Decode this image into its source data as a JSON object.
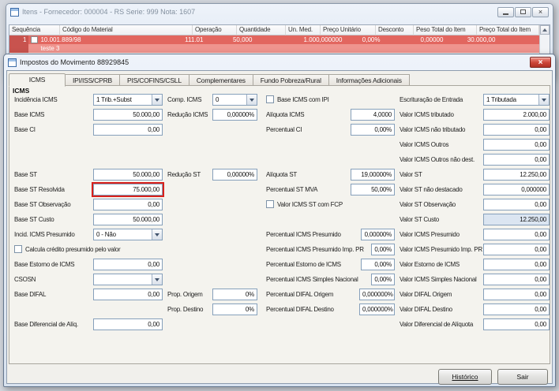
{
  "colors": {
    "highlight_border": "#d8201b",
    "row_red": "#e2665f",
    "row_red_dark": "#c8534e",
    "row_red_light": "#ef948e",
    "tinted_field": "#dbe5f1"
  },
  "items_window": {
    "title": "Itens - Fornecedor: 000004 - RS Serie: 999  Nota: 1607",
    "table": {
      "columns": [
        "Sequência",
        "Código do Material",
        "Operação",
        "Quantidade",
        "Un. Med.",
        "Preço Unitário",
        "Desconto",
        "Peso Total do Item",
        "Preço Total do Item"
      ],
      "row": {
        "seq": "1",
        "codigo": "10.001.889/98",
        "codigo_line2": "teste 3",
        "operacao": "111.01",
        "quantidade": "50,000",
        "un_med": "",
        "preco_unitario": "1.000,000000",
        "desconto": "0,00%",
        "peso_total": "0,00000",
        "preco_total": "30.000,00"
      }
    }
  },
  "tax_dialog": {
    "title": "Impostos do Movimento 88929845",
    "tabs": [
      "ICMS",
      "IPI/ISS/CPRB",
      "PIS/COFINS/CSLL",
      "Complementares",
      "Fundo Pobreza/Rural",
      "Informações Adicionais"
    ],
    "active_tab_index": 0,
    "group_label": "ICMS",
    "footer_buttons": [
      {
        "label": "Histórico"
      },
      {
        "label": "Sair"
      }
    ]
  },
  "fields": [
    {
      "c": "a",
      "r": 1,
      "label": "Incidência ICMS",
      "value": "1 Trib.+Subst",
      "type": "select"
    },
    {
      "c": "b",
      "r": 1,
      "label": "Comp. ICMS",
      "value": "0",
      "type": "select"
    },
    {
      "c": "c",
      "r": 1,
      "label": "Base ICMS com IPI",
      "type": "checkbox",
      "checked": false
    },
    {
      "c": "d",
      "r": 1,
      "label": "Escrituração de Entrada",
      "value": "1 Tributada",
      "type": "select"
    },
    {
      "c": "a",
      "r": 2,
      "label": "Base ICMS",
      "value": "50.000,00"
    },
    {
      "c": "b",
      "r": 2,
      "label": "Redução ICMS",
      "value": "0,00000%"
    },
    {
      "c": "c",
      "r": 2,
      "label": "Alíquota ICMS",
      "value": "4,0000"
    },
    {
      "c": "d",
      "r": 2,
      "label": "Valor ICMS tributado",
      "value": "2.000,00"
    },
    {
      "c": "a",
      "r": 3,
      "label": "Base CI",
      "value": "0,00"
    },
    {
      "c": "c",
      "r": 3,
      "label": "Percentual CI",
      "value": "0,00%"
    },
    {
      "c": "d",
      "r": 3,
      "label": "Valor ICMS não tributado",
      "value": "0,00"
    },
    {
      "c": "d",
      "r": 4,
      "label": "Valor ICMS Outros",
      "value": "0,00"
    },
    {
      "c": "d",
      "r": 5,
      "label": "Valor ICMS Outros não dest.",
      "value": "0,00"
    },
    {
      "c": "a",
      "r": 6,
      "label": "Base ST",
      "value": "50.000,00"
    },
    {
      "c": "b",
      "r": 6,
      "label": "Redução ST",
      "value": "0,00000%"
    },
    {
      "c": "c",
      "r": 6,
      "label": "Alíquota ST",
      "value": "19,00000%"
    },
    {
      "c": "d",
      "r": 6,
      "label": "Valor ST",
      "value": "12.250,00"
    },
    {
      "c": "a",
      "r": 7,
      "label": "Base ST Resolvida",
      "value": "75.000,00",
      "highlight": true
    },
    {
      "c": "c",
      "r": 7,
      "label": "Percentual ST MVA",
      "value": "50,00%"
    },
    {
      "c": "d",
      "r": 7,
      "label": "Valor ST não destacado",
      "value": "0,000000"
    },
    {
      "c": "a",
      "r": 8,
      "label": "Base ST Observação",
      "value": "0,00"
    },
    {
      "c": "c",
      "r": 8,
      "label": "Valor ICMS ST com FCP",
      "type": "checkbox",
      "checked": false
    },
    {
      "c": "d",
      "r": 8,
      "label": "Valor ST Observação",
      "value": "0,00"
    },
    {
      "c": "a",
      "r": 9,
      "label": "Base ST Custo",
      "value": "50.000,00"
    },
    {
      "c": "d",
      "r": 9,
      "label": "Valor ST Custo",
      "value": "12.250,00",
      "tinted": true
    },
    {
      "c": "a",
      "r": 10,
      "label": "Incid. ICMS Presumido",
      "value": "0 - Não",
      "type": "select"
    },
    {
      "c": "c",
      "r": 10,
      "label": "Percentual ICMS Presumido",
      "value": "0,00000%"
    },
    {
      "c": "d",
      "r": 10,
      "label": "Valor ICMS Presumido",
      "value": "0,00"
    },
    {
      "c": "a",
      "r": 11,
      "label": "Calcula crédito presumido pelo valor",
      "type": "checkbox",
      "checked": false
    },
    {
      "c": "c",
      "r": 11,
      "label": "Percentual ICMS Presumido Imp. PR",
      "value": "0,00%"
    },
    {
      "c": "d",
      "r": 11,
      "label": "Valor ICMS Presumido Imp. PR",
      "value": "0,00"
    },
    {
      "c": "a",
      "r": 12,
      "label": "Base Estorno de ICMS",
      "value": "0,00"
    },
    {
      "c": "c",
      "r": 12,
      "label": "Percentual Estorno de ICMS",
      "value": "0,00%"
    },
    {
      "c": "d",
      "r": 12,
      "label": "Valor Estorno de ICMS",
      "value": "0,00"
    },
    {
      "c": "a",
      "r": 13,
      "label": "CSOSN",
      "value": "",
      "type": "select"
    },
    {
      "c": "c",
      "r": 13,
      "label": "Percentual ICMS Simples Nacional",
      "value": "0,00%"
    },
    {
      "c": "d",
      "r": 13,
      "label": "Valor ICMS Simples Nacional",
      "value": "0,00"
    },
    {
      "c": "a",
      "r": 14,
      "label": "Base DIFAL",
      "value": "0,00"
    },
    {
      "c": "b",
      "r": 14,
      "label": "Prop. Origem",
      "value": "0%"
    },
    {
      "c": "c",
      "r": 14,
      "label": "Percentual DIFAL Origem",
      "value": "0,000000%"
    },
    {
      "c": "d",
      "r": 14,
      "label": "Valor DIFAL Origem",
      "value": "0,00"
    },
    {
      "c": "b",
      "r": 15,
      "label": "Prop. Destino",
      "value": "0%"
    },
    {
      "c": "c",
      "r": 15,
      "label": "Percentual DIFAL Destino",
      "value": "0,000000%"
    },
    {
      "c": "d",
      "r": 15,
      "label": "Valor DIFAL Destino",
      "value": "0,00"
    },
    {
      "c": "a",
      "r": 16,
      "label": "Base Diferencial de Alíq.",
      "value": "0,00"
    },
    {
      "c": "d",
      "r": 16,
      "label": "Valor Diferencial de Alíquota",
      "value": "0,00"
    }
  ]
}
